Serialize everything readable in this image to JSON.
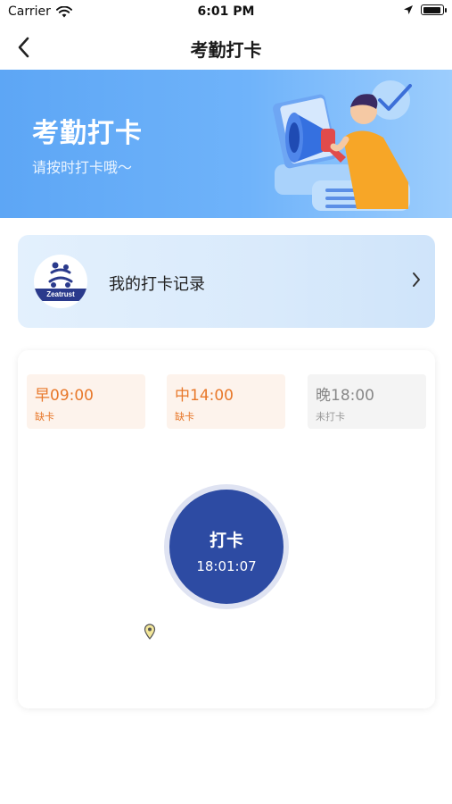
{
  "status_bar": {
    "carrier": "Carrier",
    "time": "6:01 PM"
  },
  "nav": {
    "title": "考勤打卡",
    "back_icon": "chevron-left-icon"
  },
  "banner": {
    "title": "考勤打卡",
    "subtitle": "请按时打卡哦～"
  },
  "record": {
    "label": "我的打卡记录",
    "logo_text": "Zeatrust",
    "chevron_icon": "chevron-right-icon"
  },
  "slots": [
    {
      "time": "早09:00",
      "status": "缺卡",
      "state": "missed"
    },
    {
      "time": "中14:00",
      "status": "缺卡",
      "state": "missed"
    },
    {
      "time": "晚18:00",
      "status": "未打卡",
      "state": "pending"
    }
  ],
  "punch": {
    "label": "打卡",
    "time": "18:01:07"
  },
  "colors": {
    "primary": "#2d4ba3",
    "missed": "#e8782a",
    "banner": "#6fb3fa"
  }
}
